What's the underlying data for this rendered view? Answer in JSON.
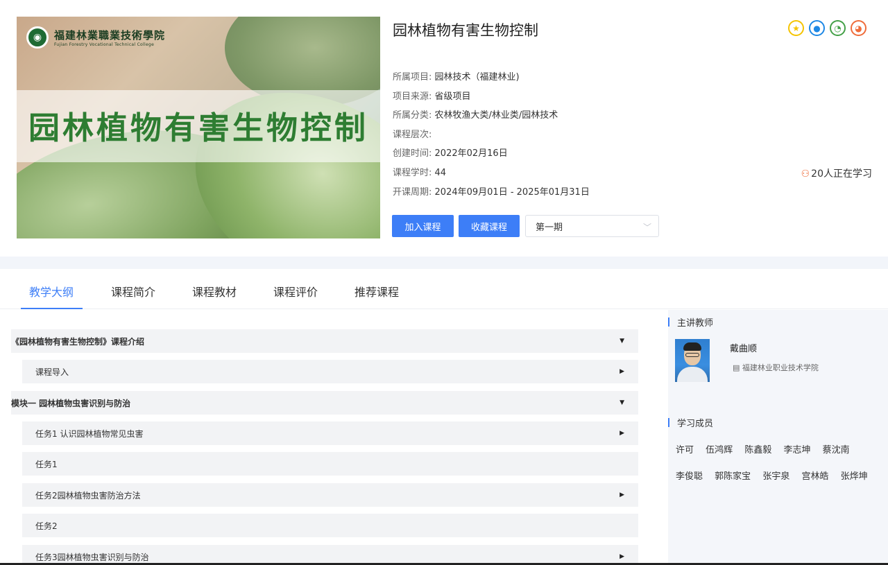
{
  "cover": {
    "school_name_cn": "福建林業職業技術學院",
    "school_name_en": "Fujian Forestry Vocational Technical College",
    "title": "园林植物有害生物控制"
  },
  "course": {
    "title": "园林植物有害生物控制",
    "meta": [
      {
        "label": "所属项目:",
        "value": "园林技术（福建林业)"
      },
      {
        "label": "项目来源:",
        "value": "省级项目"
      },
      {
        "label": "所属分类:",
        "value": "农林牧渔大类/林业类/园林技术"
      },
      {
        "label": "课程层次:",
        "value": ""
      },
      {
        "label": "创建时间:",
        "value": "2022年02月16日"
      },
      {
        "label": "课程学时:",
        "value": "44"
      },
      {
        "label": "开课周期:",
        "value": "2024年09月01日 - 2025年01月31日"
      }
    ],
    "learning_count": "20人正在学习",
    "share_icons": [
      "favorite-icon",
      "qq-icon",
      "wechat-icon",
      "weibo-icon"
    ]
  },
  "actions": {
    "join_label": "加入课程",
    "favorite_label": "收藏课程",
    "term_selected": "第一期"
  },
  "tabs": [
    {
      "label": "教学大纲",
      "active": true
    },
    {
      "label": "课程简介",
      "active": false
    },
    {
      "label": "课程教材",
      "active": false
    },
    {
      "label": "课程评价",
      "active": false
    },
    {
      "label": "推荐课程",
      "active": false
    }
  ],
  "outline": [
    {
      "label": "《园林植物有害生物控制》课程介绍",
      "level": "chapter",
      "arrow": "down"
    },
    {
      "label": "课程导入",
      "level": "section",
      "arrow": "right"
    },
    {
      "label": "模块一 园林植物虫害识别与防治",
      "level": "chapter",
      "arrow": "down"
    },
    {
      "label": "任务1 认识园林植物常见虫害",
      "level": "section",
      "arrow": "right"
    },
    {
      "label": "任务1",
      "level": "section",
      "arrow": ""
    },
    {
      "label": "任务2园林植物虫害防治方法",
      "level": "section",
      "arrow": "right"
    },
    {
      "label": "任务2",
      "level": "section",
      "arrow": ""
    },
    {
      "label": "任务3园林植物虫害识别与防治",
      "level": "section",
      "arrow": "right"
    }
  ],
  "sidebar": {
    "teacher_heading": "主讲教师",
    "teacher_name": "戴曲顺",
    "teacher_school": "福建林业职业技术学院",
    "members_heading": "学习成员",
    "members": [
      "许可",
      "伍鸿辉",
      "陈鑫毅",
      "李志坤",
      "蔡沈南",
      "李俊聪",
      "郭陈家宝",
      "张宇泉",
      "宫林皓",
      "张烨坤"
    ]
  },
  "colors": {
    "accent": "#3d7ef7",
    "title_green": "#2e7d32",
    "row_bg": "#f2f3f5",
    "sidebar_bg": "#f4f6fa"
  }
}
